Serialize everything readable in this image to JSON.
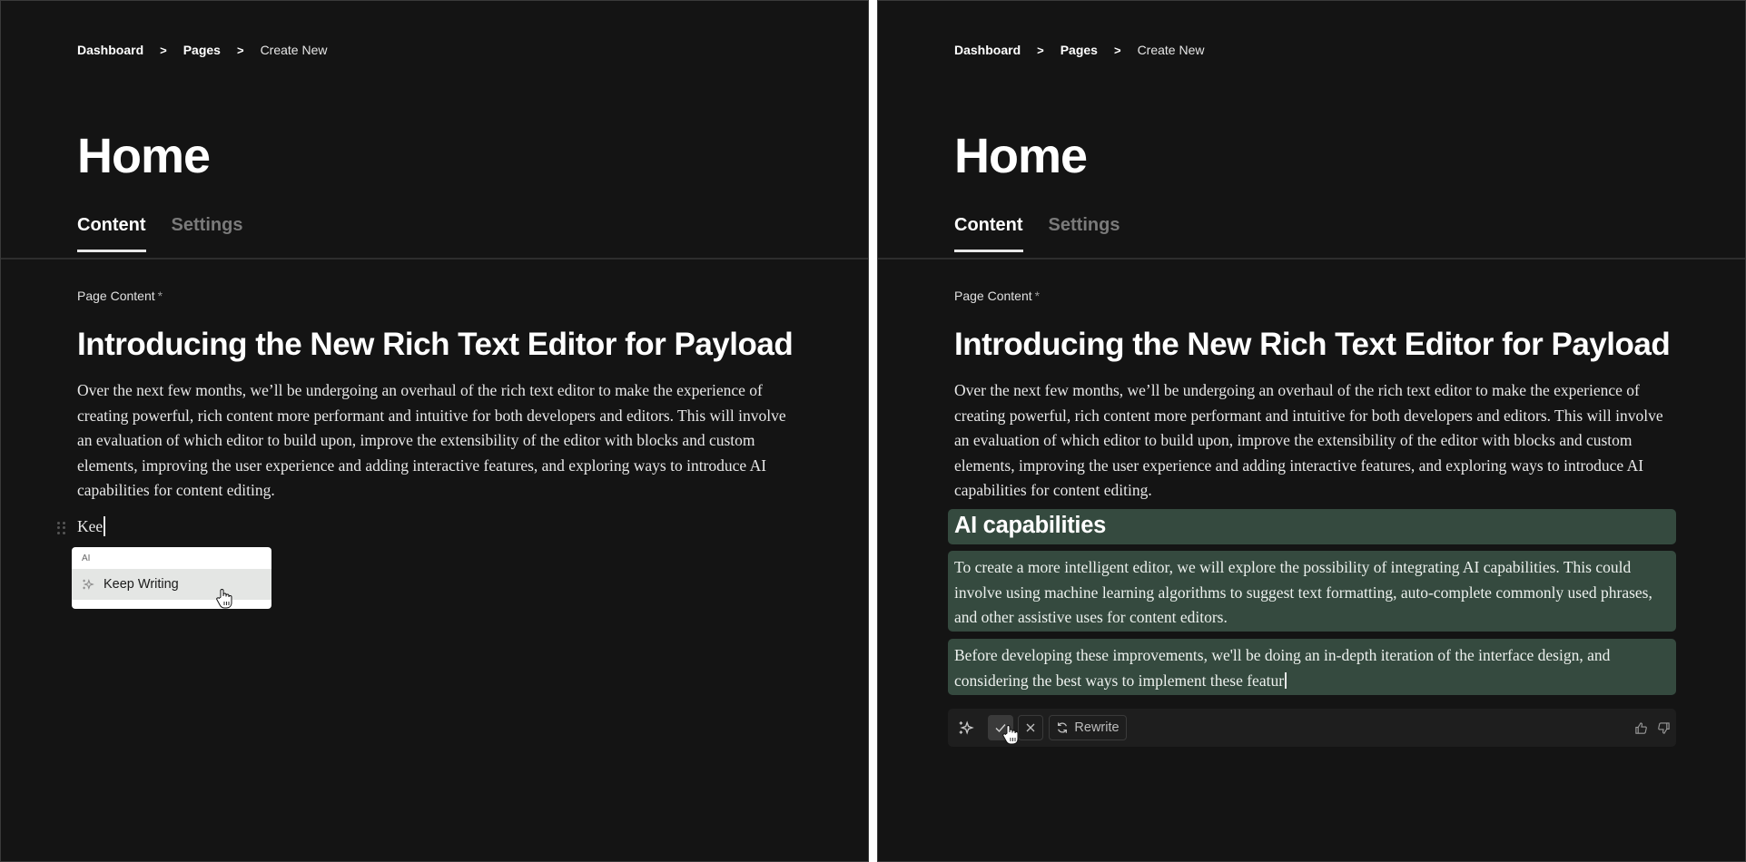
{
  "left_panel": {
    "breadcrumb": {
      "items": [
        "Dashboard",
        "Pages"
      ],
      "current": "Create New",
      "separator": ">"
    },
    "page_title": "Home",
    "tabs": [
      {
        "label": "Content",
        "active": true
      },
      {
        "label": "Settings",
        "active": false
      }
    ],
    "field_label": "Page Content",
    "required_mark": "*",
    "doc": {
      "heading": "Introducing the New Rich Text Editor for Payload",
      "paragraph": "Over the next few months, we’ll be undergoing an overhaul of the rich text editor to make the experience of creating powerful, rich content more performant and intuitive for both developers and editors. This will involve an evaluation of which editor to build upon, improve the extensibility of the editor with blocks and custom elements, improving the user experience and adding interactive features, and exploring ways to introduce AI capabilities for content editing.",
      "typed_text": "Kee"
    },
    "slash_menu": {
      "group_label": "AI",
      "items": [
        {
          "label": "Keep Writing",
          "icon": "sparkle-icon",
          "highlighted": true
        }
      ]
    }
  },
  "right_panel": {
    "breadcrumb": {
      "items": [
        "Dashboard",
        "Pages"
      ],
      "current": "Create New",
      "separator": ">"
    },
    "page_title": "Home",
    "tabs": [
      {
        "label": "Content",
        "active": true
      },
      {
        "label": "Settings",
        "active": false
      }
    ],
    "field_label": "Page Content",
    "required_mark": "*",
    "doc": {
      "heading": "Introducing the New Rich Text Editor for Payload",
      "paragraph": "Over the next few months, we’ll be undergoing an overhaul of the rich text editor to make the experience of creating powerful, rich content more performant and intuitive for both developers and editors. This will involve an evaluation of which editor to build upon, improve the extensibility of the editor with blocks and custom elements, improving the user experience and adding interactive features, and exploring ways to introduce AI capabilities for content editing.",
      "ai_heading": "AI capabilities",
      "ai_paragraph_1": "To create a more intelligent editor, we will explore the possibility of integrating AI capabilities. This could involve using machine learning algorithms to suggest text formatting, auto-complete commonly used phrases, and other assistive uses for content editors.",
      "ai_paragraph_2": "Before developing these improvements, we'll be doing an in-depth iteration of the interface design, and considering the best ways to implement these featur"
    },
    "ai_toolbar": {
      "rewrite_label": "Rewrite",
      "highlight_color": "#354a3f"
    }
  }
}
